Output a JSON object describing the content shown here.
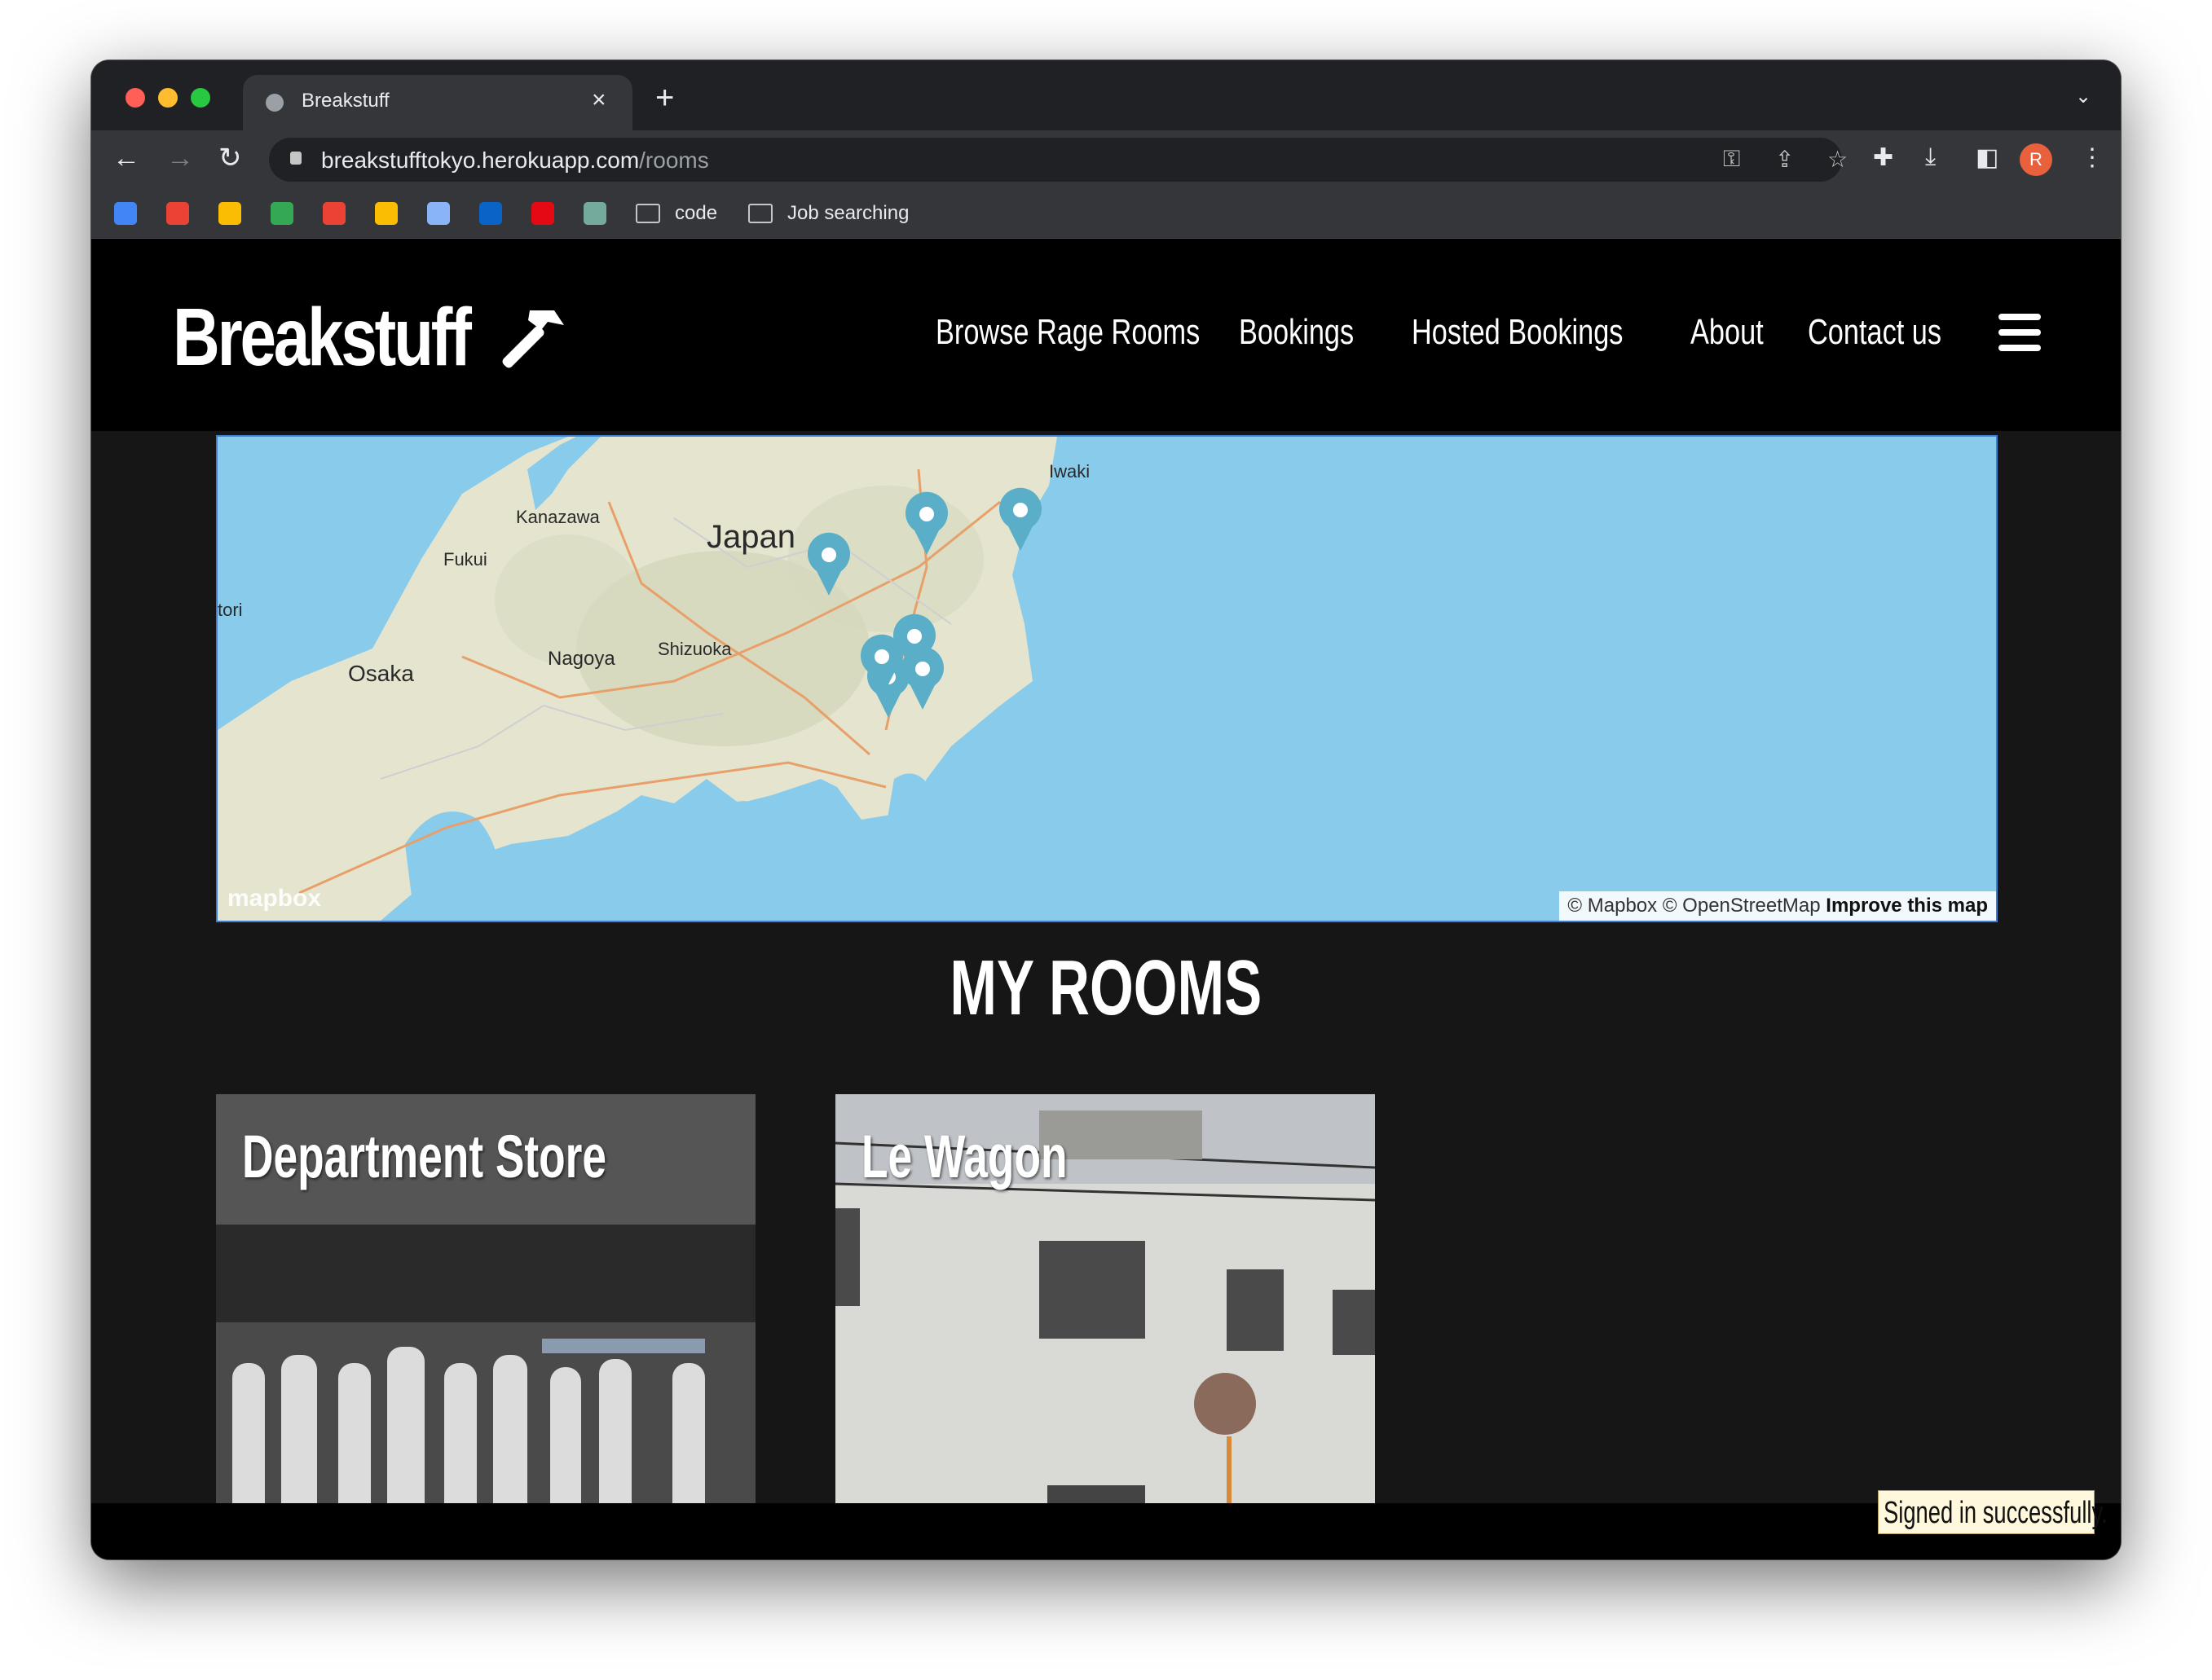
{
  "browser": {
    "tab_title": "Breakstuff",
    "url_host": "breakstufftokyo.herokuapp.com",
    "url_path": "/rooms",
    "profile_initial": "R",
    "bookmarks": [
      {
        "label": "code",
        "icon": "folder-icon"
      },
      {
        "label": "Job searching",
        "icon": "folder-icon"
      }
    ]
  },
  "site": {
    "brand": "Breakstuff",
    "nav": [
      {
        "label": "Browse Rage Rooms"
      },
      {
        "label": "Bookings"
      },
      {
        "label": "Hosted Bookings"
      },
      {
        "label": "About"
      },
      {
        "label": "Contact us"
      }
    ]
  },
  "map": {
    "country_label": "Japan",
    "cities": [
      "Iwaki",
      "Kanazawa",
      "Fukui",
      "tori",
      "Nagoya",
      "Shizuoka",
      "Osaka"
    ],
    "logo": "mapbox",
    "attribution": "© Mapbox © OpenStreetMap",
    "improve_link": "Improve this map",
    "marker_count": 7
  },
  "rooms": {
    "heading": "MY ROOMS",
    "items": [
      {
        "title": "Department Store"
      },
      {
        "title": "Le Wagon"
      }
    ]
  },
  "flash": {
    "message": "Signed in successfully."
  },
  "colors": {
    "page_bg": "#161617",
    "navbar_bg": "#000000",
    "water": "#89cbeb",
    "marker": "#5aaec8",
    "flash_bg": "#fff8dc"
  }
}
